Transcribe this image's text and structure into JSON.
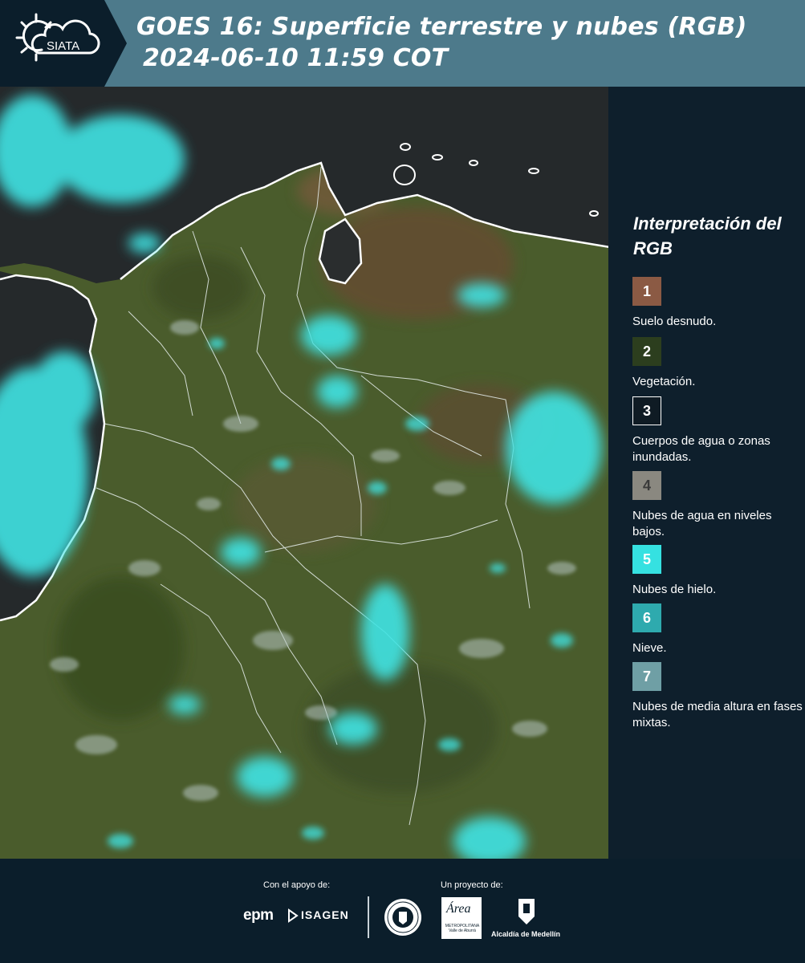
{
  "header": {
    "logo_text": "SIATA",
    "title_line1": "GOES 16: Superficie terrestre y nubes (RGB)",
    "title_line2": "2024-06-10 11:59 COT"
  },
  "map": {
    "icon": "satellite-rgb-map",
    "colors": {
      "ocean": "#24292b",
      "vegetation": "#4a5c2c",
      "bare_soil": "#7a5a3c",
      "ice_clouds": "#3fe4e4",
      "low_clouds": "#b7c7c4",
      "borders": "#ffffff"
    }
  },
  "legend": {
    "title": "Interpretación del RGB",
    "items": [
      {
        "number": "1",
        "label": "Suelo desnudo.",
        "color": "#8b5a44"
      },
      {
        "number": "2",
        "label": "Vegetación.",
        "color": "#2c3e1e"
      },
      {
        "number": "3",
        "label": "Cuerpos de agua o zonas inundadas.",
        "color": "#0f1b24"
      },
      {
        "number": "4",
        "label": "Nubes de agua en niveles bajos.",
        "color": "#8a8880"
      },
      {
        "number": "5",
        "label": "Nubes de hielo.",
        "color": "#35e1e1"
      },
      {
        "number": "6",
        "label": "Nieve.",
        "color": "#2eaaae"
      },
      {
        "number": "7",
        "label": "Nubes de media altura en fases mixtas.",
        "color": "#6f9fa5"
      }
    ]
  },
  "footer": {
    "support_label": "Con el apoyo de:",
    "project_label": "Un proyecto de:",
    "epm": "epm",
    "isagen": "ISAGEN",
    "area_name": "Área",
    "area_sub": "METROPOLITANA Valle de Aburrá",
    "alcaldia": "Alcaldía de Medellín"
  }
}
